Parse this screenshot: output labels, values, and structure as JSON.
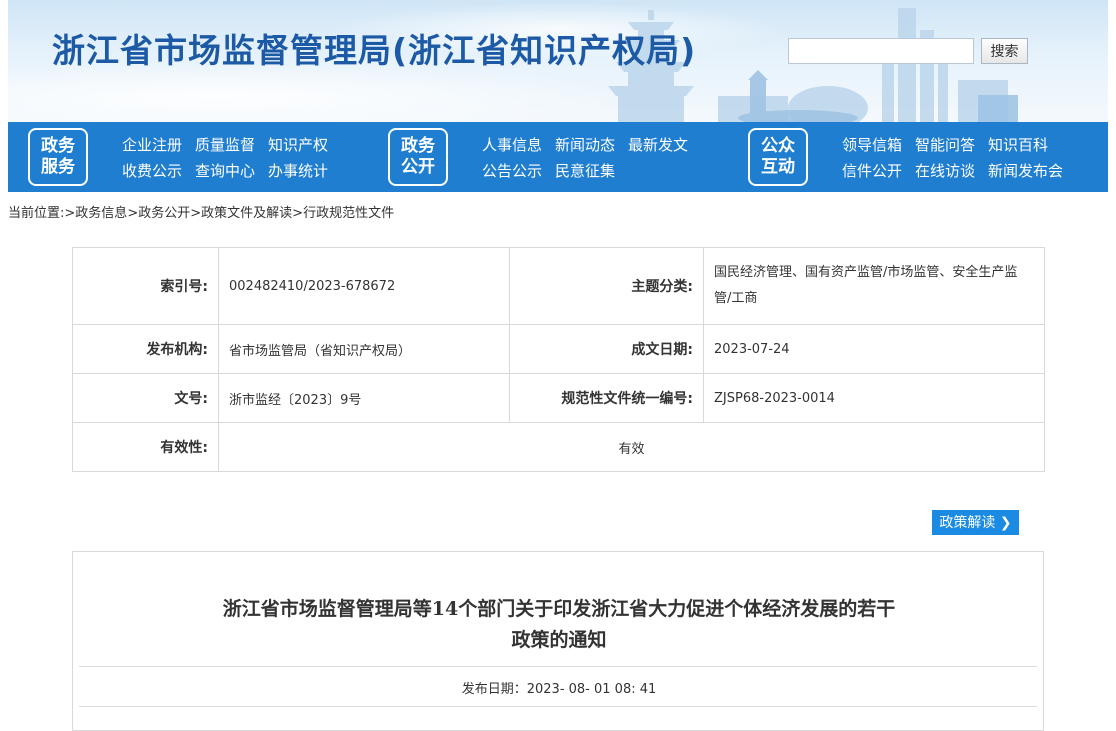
{
  "header": {
    "site_title": "浙江省市场监督管理局(浙江省知识产权局)",
    "search_placeholder": "",
    "search_button": "搜索"
  },
  "nav": {
    "groups": [
      {
        "badge": [
          "政务",
          "服务"
        ],
        "rows": [
          [
            "企业注册",
            "质量监督",
            "知识产权"
          ],
          [
            "收费公示",
            "查询中心",
            "办事统计"
          ]
        ]
      },
      {
        "badge": [
          "政务",
          "公开"
        ],
        "rows": [
          [
            "人事信息",
            "新闻动态",
            "最新发文"
          ],
          [
            "公告公示",
            "民意征集"
          ]
        ]
      },
      {
        "badge": [
          "公众",
          "互动"
        ],
        "rows": [
          [
            "领导信箱",
            "智能问答",
            "知识百科"
          ],
          [
            "信件公开",
            "在线访谈",
            "新闻发布会"
          ]
        ]
      }
    ]
  },
  "breadcrumb": {
    "prefix": "当前位置:",
    "items": [
      "政务信息",
      "政务公开",
      "政策文件及解读",
      "行政规范性文件"
    ],
    "separator": ">"
  },
  "metadata": {
    "index_label": "索引号:",
    "index_value": "002482410/2023-678672",
    "category_label": "主题分类:",
    "category_value": "国民经济管理、国有资产监管/市场监管、安全生产监管/工商",
    "issuer_label": "发布机构:",
    "issuer_value": "省市场监管局（省知识产权局）",
    "date_label": "成文日期:",
    "date_value": "2023-07-24",
    "doc_no_label": "文号:",
    "doc_no_value": "浙市监经〔2023〕9号",
    "code_label": "规范性文件统一编号:",
    "code_value": "ZJSP68-2023-0014",
    "validity_label": "有效性:",
    "validity_value": "有效"
  },
  "policy_button": "政策解读",
  "article": {
    "title_line1": "浙江省市场监督管理局等14个部门关于印发浙江省大力促进个体经济发展的若干",
    "title_line2": "政策的通知",
    "publish_label": "发布日期：",
    "publish_value": "2023- 08- 01 08: 41"
  },
  "colors": {
    "title_blue": "#1d5aa5",
    "nav_blue": "#1f7ed0",
    "button_blue": "#1a8ae2"
  }
}
